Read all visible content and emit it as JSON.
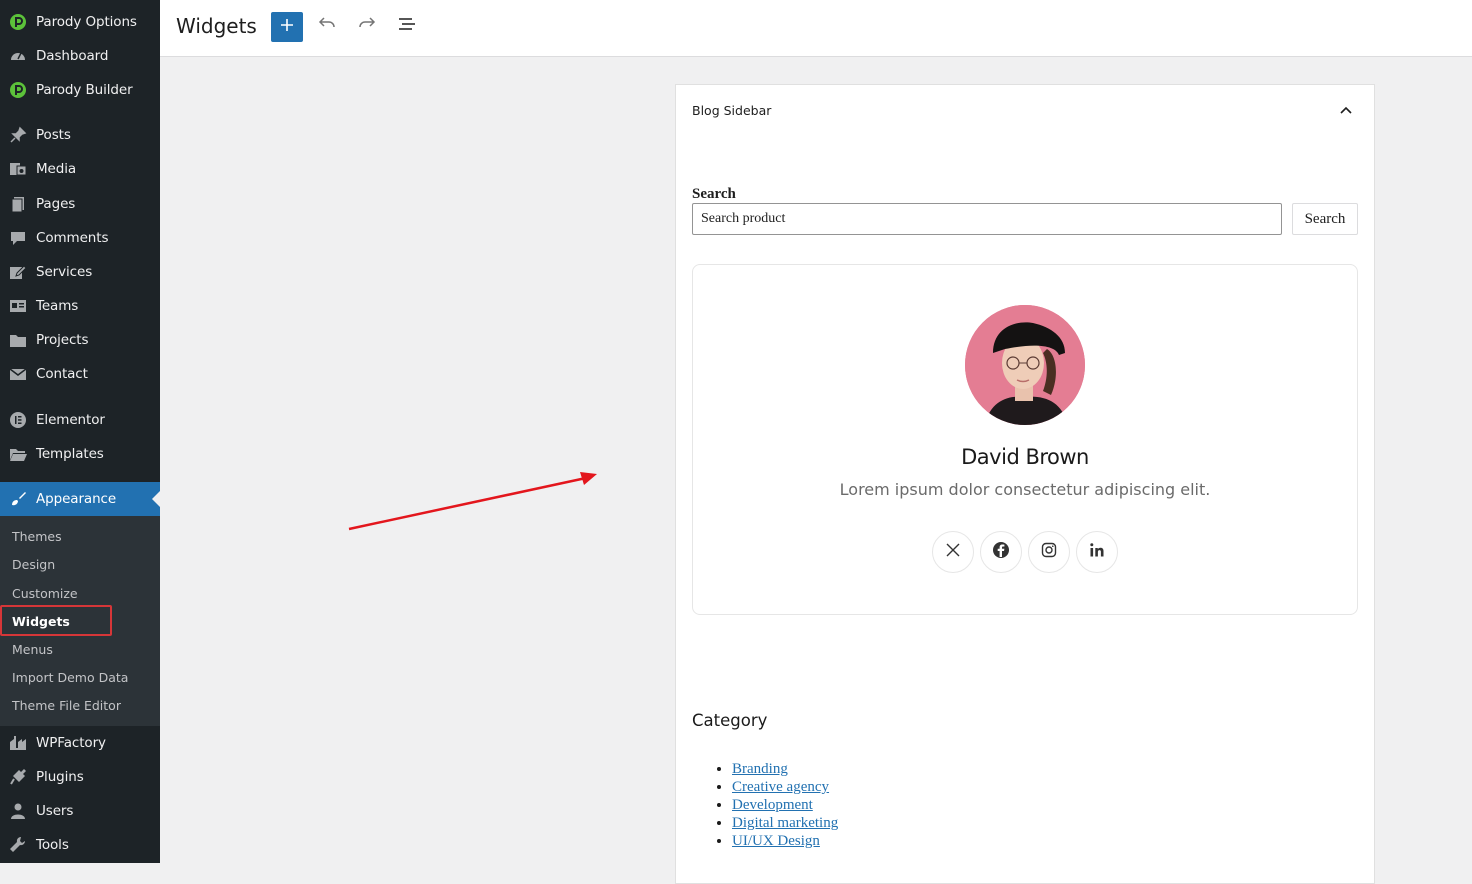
{
  "sidebar": {
    "top_items": [
      {
        "label": "Parody Options",
        "icon": "parody-logo-icon"
      },
      {
        "label": "Dashboard",
        "icon": "dashboard-icon"
      },
      {
        "label": "Parody Builder",
        "icon": "parody-logo-icon"
      },
      {
        "label": "Posts",
        "icon": "pin-icon"
      },
      {
        "label": "Media",
        "icon": "media-icon"
      },
      {
        "label": "Pages",
        "icon": "pages-icon"
      },
      {
        "label": "Comments",
        "icon": "comment-icon"
      },
      {
        "label": "Services",
        "icon": "edit-icon"
      },
      {
        "label": "Teams",
        "icon": "id-card-icon"
      },
      {
        "label": "Projects",
        "icon": "folder-icon"
      },
      {
        "label": "Contact",
        "icon": "mail-icon"
      },
      {
        "label": "Elementor",
        "icon": "elementor-icon"
      },
      {
        "label": "Templates",
        "icon": "folder-open-icon"
      },
      {
        "label": "Appearance",
        "icon": "brush-icon"
      }
    ],
    "appearance_submenu": [
      "Themes",
      "Design",
      "Customize",
      "Widgets",
      "Menus",
      "Import Demo Data",
      "Theme File Editor"
    ],
    "bottom_items": [
      {
        "label": "WPFactory",
        "icon": "factory-icon"
      },
      {
        "label": "Plugins",
        "icon": "plug-icon"
      },
      {
        "label": "Users",
        "icon": "user-icon"
      },
      {
        "label": "Tools",
        "icon": "wrench-icon"
      }
    ]
  },
  "header": {
    "title": "Widgets",
    "add_icon": "plus-icon",
    "undo_icon": "undo-icon",
    "redo_icon": "redo-icon",
    "list_view_icon": "list-view-icon"
  },
  "widget_area": {
    "title": "Blog Sidebar",
    "search": {
      "label": "Search",
      "placeholder": "Search product",
      "button_label": "Search"
    },
    "profile": {
      "name": "David Brown",
      "bio": "Lorem ipsum dolor consectetur adipiscing elit.",
      "socials": [
        "x-icon",
        "facebook-icon",
        "instagram-icon",
        "linkedin-icon"
      ]
    },
    "category": {
      "title": "Category",
      "items": [
        "Branding",
        "Creative agency",
        "Development",
        "Digital marketing",
        "UI/UX Design"
      ]
    }
  },
  "colors": {
    "sidebar_bg": "#1d2327",
    "submenu_bg": "#2c3338",
    "accent": "#2271b1",
    "highlight_border": "#d63638",
    "arrow": "#e3161d",
    "parody_green": "#4caf50"
  }
}
